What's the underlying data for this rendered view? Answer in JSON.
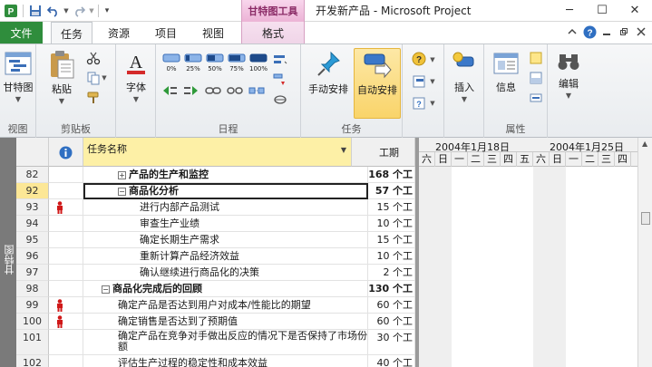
{
  "titlebar": {
    "title": "开发新产品 - Microsoft Project",
    "context_tab_group": "甘特图工具",
    "minimize": "─",
    "maximize": "☐",
    "close": "✕"
  },
  "tabs": {
    "file": "文件",
    "items": [
      "任务",
      "资源",
      "项目",
      "视图"
    ],
    "context": "格式"
  },
  "ribbon": {
    "groups": {
      "view": {
        "label": "视图",
        "gantt_btn": "甘特图"
      },
      "clipboard": {
        "label": "剪贴板",
        "paste_btn": "粘贴"
      },
      "font": {
        "label": "",
        "font_btn": "字体"
      },
      "schedule": {
        "label": "日程",
        "pct": [
          "0%",
          "25%",
          "50%",
          "75%",
          "100%"
        ]
      },
      "tasks": {
        "label": "任务",
        "manual_btn": "手动安排",
        "auto_btn": "自动安排"
      },
      "insert": {
        "label": "",
        "insert_btn": "插入"
      },
      "properties": {
        "label": "属性",
        "info_btn": "信息"
      },
      "editing": {
        "label": "",
        "edit_btn": "编辑"
      }
    }
  },
  "sheet": {
    "viewbar_label": "甘特图",
    "columns": {
      "name": "任务名称",
      "duration": "工期"
    },
    "rows": [
      {
        "id": "82",
        "name": "产品的生产和监控",
        "duration": "168 个工",
        "level": 2,
        "summary": true,
        "expander": "+"
      },
      {
        "id": "92",
        "name": "商品化分析",
        "duration": "57 个工",
        "level": 2,
        "summary": true,
        "expander": "−",
        "selected": true
      },
      {
        "id": "93",
        "name": "进行内部产品测试",
        "duration": "15 个工",
        "level": 3,
        "resource": true
      },
      {
        "id": "94",
        "name": "审查生产业绩",
        "duration": "10 个工",
        "level": 3
      },
      {
        "id": "95",
        "name": "确定长期生产需求",
        "duration": "15 个工",
        "level": 3
      },
      {
        "id": "96",
        "name": "重新计算产品经济效益",
        "duration": "10 个工",
        "level": 3
      },
      {
        "id": "97",
        "name": "确认继续进行商品化的决策",
        "duration": "2 个工",
        "level": 3
      },
      {
        "id": "98",
        "name": "商品化完成后的回顾",
        "duration": "130 个工",
        "level": 1,
        "summary": true,
        "expander": "−"
      },
      {
        "id": "99",
        "name": "确定产品是否达到用户对成本/性能比的期望",
        "duration": "60 个工",
        "level": 2,
        "resource": true
      },
      {
        "id": "100",
        "name": "确定销售是否达到了预期值",
        "duration": "60 个工",
        "level": 2,
        "resource": true
      },
      {
        "id": "101",
        "name": "确定产品在竞争对手做出反应的情况下是否保持了市场份额",
        "duration": "30 个工",
        "level": 2,
        "tall": true
      },
      {
        "id": "102",
        "name": "评估生产过程的稳定性和成本效益",
        "duration": "40 个工",
        "level": 2
      }
    ]
  },
  "gantt": {
    "weeks": [
      "2004年1月18日",
      "2004年1月25日"
    ],
    "days": [
      "六",
      "日",
      "一",
      "二",
      "三",
      "四",
      "五",
      "六",
      "日",
      "一",
      "二",
      "三",
      "四"
    ]
  },
  "colors": {
    "file_tab": "#2f8d3c",
    "selected_header": "#fdf0a6",
    "resource_icon": "#d01919"
  }
}
